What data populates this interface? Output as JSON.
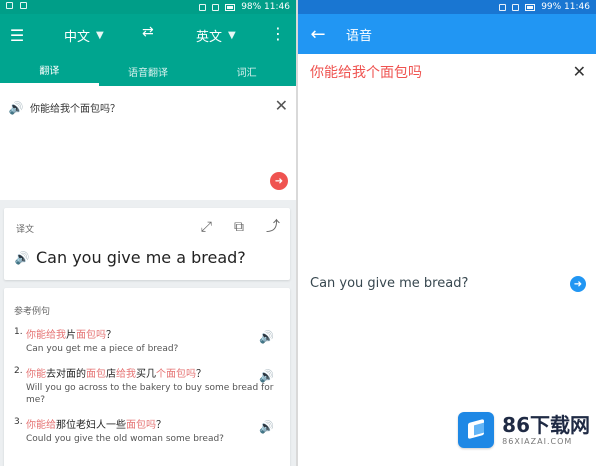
{
  "left": {
    "status": {
      "left_icons": "",
      "right_text": "98%   11:46"
    },
    "toolbar": {
      "menu_icon": "menu-icon",
      "src_lang": "中文",
      "tgt_lang": "英文",
      "swap_icon": "swap-icon",
      "more_icon": "more-vert-icon"
    },
    "tabs": [
      {
        "label": "翻译",
        "active": true
      },
      {
        "label": "语音翻译",
        "active": false
      },
      {
        "label": "词汇",
        "active": false
      }
    ],
    "input": {
      "text": "你能给我个面包吗？",
      "close_icon": "close-icon"
    },
    "translation_card": {
      "label": "译文",
      "text": "Can you give me a bread?",
      "actions": [
        "expand-icon",
        "copy-icon",
        "share-icon"
      ]
    },
    "examples": {
      "title": "参考例句",
      "items": [
        {
          "num": "1.",
          "zh_parts": [
            {
              "text": "你能给我",
              "hl": true
            },
            {
              "text": "片",
              "hl": false
            },
            {
              "text": "面包吗",
              "hl": true
            },
            {
              "text": "？",
              "hl": false
            }
          ],
          "en": "Can you get me a piece of bread?"
        },
        {
          "num": "2.",
          "zh_parts": [
            {
              "text": "你能",
              "hl": true
            },
            {
              "text": "去对面的",
              "hl": false
            },
            {
              "text": "面包",
              "hl": true
            },
            {
              "text": "店",
              "hl": false
            },
            {
              "text": "给我",
              "hl": true
            },
            {
              "text": "买几",
              "hl": false
            },
            {
              "text": "个面包吗",
              "hl": true
            },
            {
              "text": "？",
              "hl": false
            }
          ],
          "en": "Will you go across to the bakery to buy some bread for me?"
        },
        {
          "num": "3.",
          "zh_parts": [
            {
              "text": "你能给",
              "hl": true
            },
            {
              "text": "那位老妇人一些",
              "hl": false
            },
            {
              "text": "面包吗",
              "hl": true
            },
            {
              "text": "？",
              "hl": false
            }
          ],
          "en": "Could you give the old woman some bread?"
        }
      ]
    }
  },
  "right": {
    "status": {
      "right_text": "99%   11:46"
    },
    "appbar": {
      "title": "语音",
      "back_icon": "back-arrow-icon"
    },
    "voice_source": "你能给我个面包吗",
    "voice_result": "Can you give me bread?",
    "close_icon": "close-icon",
    "go_icon": "arrow-right-icon"
  },
  "watermark": {
    "main": "86下载网",
    "sub": "86XIAZAI.COM"
  },
  "colors": {
    "teal": "#00A58F",
    "blue": "#2196F3",
    "highlight": "#E57373"
  }
}
